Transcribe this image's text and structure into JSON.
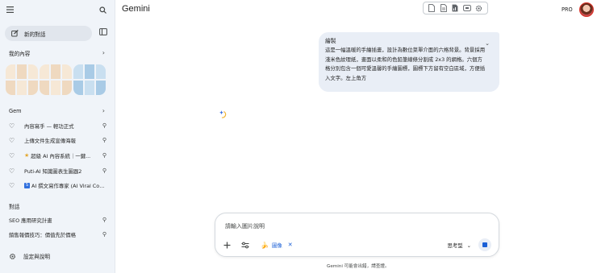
{
  "app": {
    "title": "Gemini",
    "plan_badge": "PRO"
  },
  "sidebar": {
    "new_chat_label": "新的對話",
    "my_content_title": "我的內容",
    "gem_title": "Gem",
    "gems": [
      {
        "label": "內容寫手 — 輕功正式",
        "prefix": ""
      },
      {
        "label": "上傳文件生成宣傳海報",
        "prefix": ""
      },
      {
        "label": "超級 AI 內容系統｜一鍵...",
        "prefix": "star"
      },
      {
        "label": "Puti-AI 知識圖表生圖器2",
        "prefix": ""
      },
      {
        "label": "AI 撰文寫作專家 (AI Viral Cop...",
        "prefix": "badge"
      }
    ],
    "chats_title": "對話",
    "chats": [
      {
        "label": "SEO 應用研究計畫"
      },
      {
        "label": "銷售報價技巧：價值先於價格"
      }
    ],
    "settings_label": "設定與說明"
  },
  "toolbar": {
    "icons": [
      "doc-icon",
      "doc-lines-icon",
      "doc-chart-icon",
      "screen-icon",
      "gear-icon"
    ]
  },
  "conversation": {
    "user_message": {
      "title": "繪製",
      "body": "這是一幅溫暖的手繪插畫，設計為數位菜單介面的六格背景。背景採用淺米色紋理紙，畫面以柔和的色鉛筆線條分割成 2x3 的網格。六個方格分別包含一個可愛溫馨的手繪圖標，圖標下方留有空白區域，方便插入文字。左上角方"
    }
  },
  "composer": {
    "placeholder": "請輸入圖片說明",
    "chip_label": "圖像",
    "mode_label": "思考型",
    "disclaimer": "Gemini 可能會出錯，請查證。"
  },
  "colors": {
    "accent": "#1a5fd6",
    "sidebar_bg": "#f0f4f9",
    "bubble_bg": "#e9eef6"
  }
}
